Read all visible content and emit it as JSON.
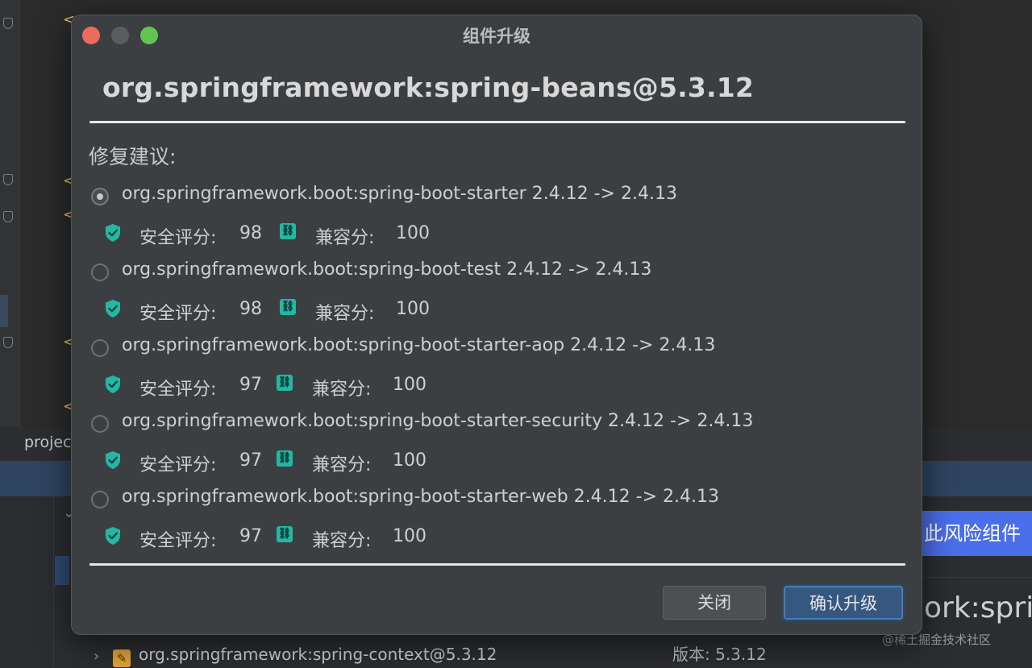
{
  "background": {
    "project_tab": "projec",
    "risk_button": "此风险组件",
    "partial_artifact": "ork:spri",
    "version_line": "版本: 5.3.12",
    "context_item": "org.springframework:spring-context@5.3.12",
    "watermark": "@稀土掘金技术社区"
  },
  "dialog": {
    "title": "组件升级",
    "package": "org.springframework:spring-beans@5.3.12",
    "fix_label": "修复建议:",
    "security_label": "安全评分:",
    "compat_label": "兼容分:",
    "options": [
      {
        "label": "org.springframework.boot:spring-boot-starter 2.4.12 -> 2.4.13",
        "security": "98",
        "compat": "100",
        "selected": true
      },
      {
        "label": "org.springframework.boot:spring-boot-test 2.4.12 -> 2.4.13",
        "security": "98",
        "compat": "100",
        "selected": false
      },
      {
        "label": "org.springframework.boot:spring-boot-starter-aop 2.4.12 -> 2.4.13",
        "security": "97",
        "compat": "100",
        "selected": false
      },
      {
        "label": "org.springframework.boot:spring-boot-starter-security 2.4.12 -> 2.4.13",
        "security": "97",
        "compat": "100",
        "selected": false
      },
      {
        "label": "org.springframework.boot:spring-boot-starter-web 2.4.12 -> 2.4.13",
        "security": "97",
        "compat": "100",
        "selected": false
      }
    ],
    "close_button": "关闭",
    "confirm_button": "确认升级"
  },
  "icons": {
    "security": "shield-check-icon",
    "compat": "link-icon"
  },
  "colors": {
    "dialog_bg": "#3c3f41",
    "accent_teal": "#24b8a4",
    "confirm_bg": "#365880",
    "risk_button_bg": "#4b6eea"
  }
}
